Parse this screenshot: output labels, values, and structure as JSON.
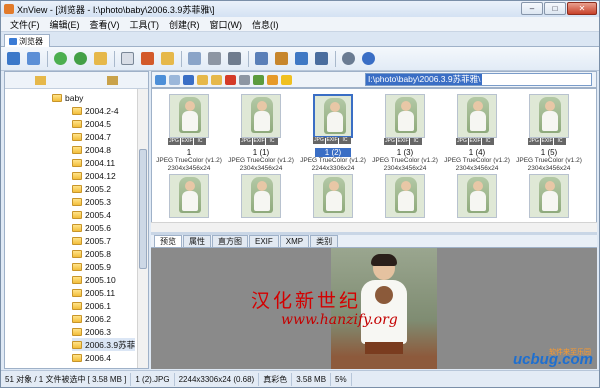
{
  "window": {
    "title": "XnView - [浏览器 - I:\\photo\\baby\\2006.3.9苏菲雅\\]",
    "minimize": "–",
    "maximize": "□",
    "close": "✕"
  },
  "menu": [
    "文件(F)",
    "编辑(E)",
    "查看(V)",
    "工具(T)",
    "创建(R)",
    "窗口(W)",
    "信息(I)"
  ],
  "browser_tab": "浏览器",
  "path": "I:\\photo\\baby\\2006.3.9苏菲雅\\",
  "tree": {
    "root": "baby",
    "folders": [
      "2004.2-4",
      "2004.5",
      "2004.7",
      "2004.8",
      "2004.11",
      "2004.12",
      "2005.2",
      "2005.3",
      "2005.4",
      "2005.6",
      "2005.7",
      "2005.8",
      "2005.9",
      "2005.10",
      "2005.11",
      "2006.1",
      "2006.2",
      "2006.3",
      "2006.3.9苏菲",
      "2006.4"
    ]
  },
  "thumbnails": [
    {
      "label": "1",
      "format": "JPEG TrueColor (v1.2)",
      "size": "2304x3456x24"
    },
    {
      "label": "1 (1)",
      "format": "JPEG TrueColor (v1.2)",
      "size": "2304x3456x24"
    },
    {
      "label": "1 (2)",
      "format": "JPEG TrueColor (v1.2)",
      "size": "2244x3306x24"
    },
    {
      "label": "1 (3)",
      "format": "JPEG TrueColor (v1.2)",
      "size": "2304x3456x24"
    },
    {
      "label": "1 (4)",
      "format": "JPEG TrueColor (v1.2)",
      "size": "2304x3456x24"
    },
    {
      "label": "1 (5)",
      "format": "JPEG TrueColor (v1.2)",
      "size": "2304x3456x24"
    }
  ],
  "badges": [
    "JPG",
    "EXIF",
    "IC"
  ],
  "preview_tabs": [
    "预览",
    "属性",
    "直方图",
    "EXIF",
    "XMP",
    "类别"
  ],
  "watermark": {
    "cn": "汉化新世纪",
    "url": "www.hanzify.org",
    "logo": "ucbug.com",
    "logo_sub": "软件来至乐园"
  },
  "status": [
    "51 对象 / 1 文件被选中 [ 3.58 MB ]",
    "1 (2).JPG",
    "2244x3306x24 (0.68)",
    "真彩色",
    "3.58 MB",
    "5%"
  ],
  "colors": {
    "selection": "#3a6ec5",
    "watermark_red": "#d40000",
    "logo_blue": "#1e6fd0"
  }
}
